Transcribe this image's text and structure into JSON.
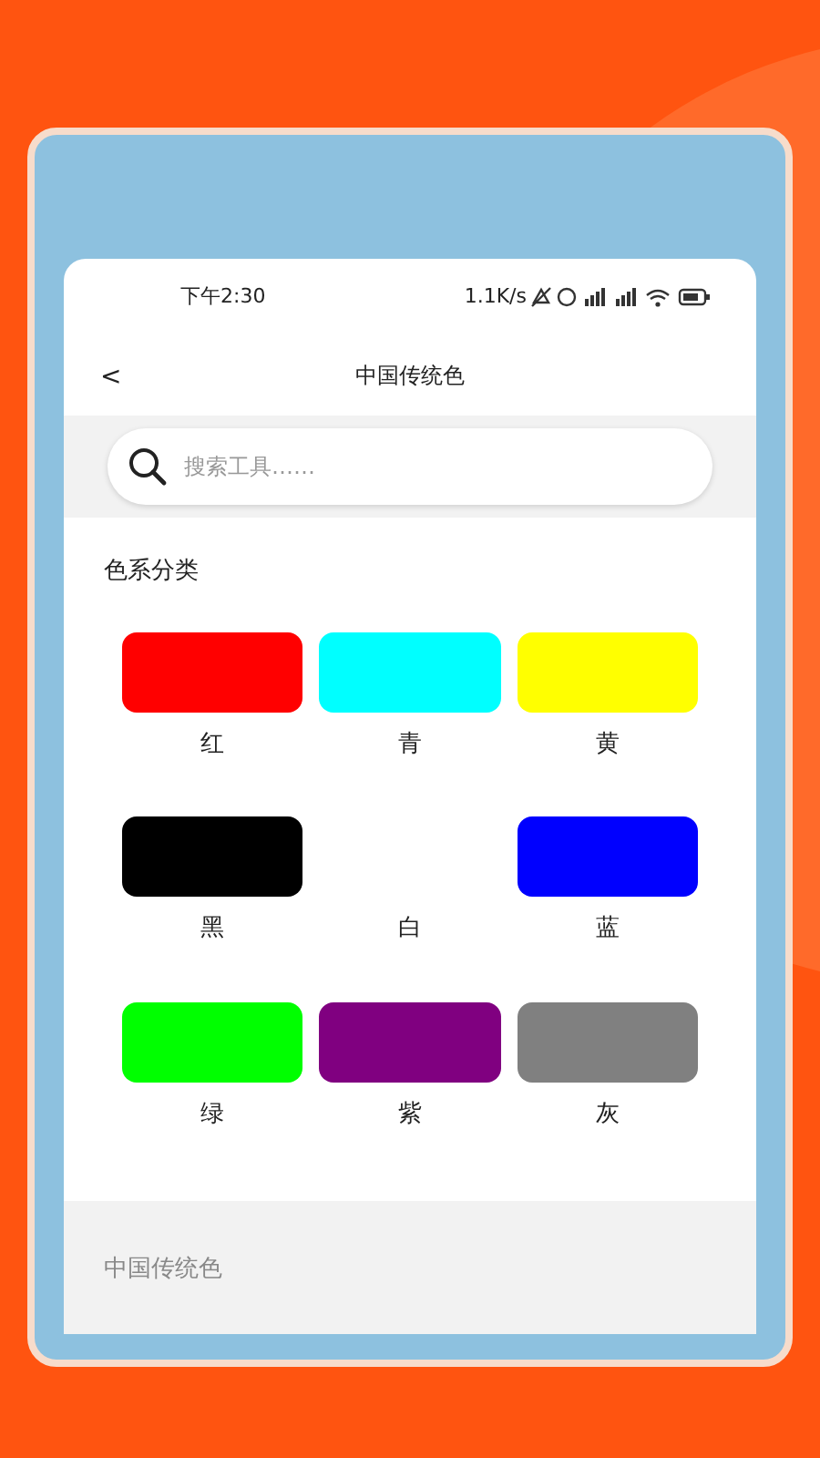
{
  "status_bar": {
    "time": "下午2:30",
    "speed": "1.1K/s"
  },
  "header": {
    "back": "<",
    "title": "中国传统色"
  },
  "search": {
    "placeholder": "搜索工具……"
  },
  "section": {
    "title": "色系分类",
    "swatches": [
      {
        "label": "红",
        "color": "#ff0000"
      },
      {
        "label": "青",
        "color": "#00ffff"
      },
      {
        "label": "黄",
        "color": "#ffff00"
      },
      {
        "label": "黑",
        "color": "#000000"
      },
      {
        "label": "白",
        "color": "#ffffff"
      },
      {
        "label": "蓝",
        "color": "#0000ff"
      },
      {
        "label": "绿",
        "color": "#00ff00"
      },
      {
        "label": "紫",
        "color": "#800080"
      },
      {
        "label": "灰",
        "color": "#808080"
      }
    ]
  },
  "footer": {
    "title": "中国传统色"
  }
}
